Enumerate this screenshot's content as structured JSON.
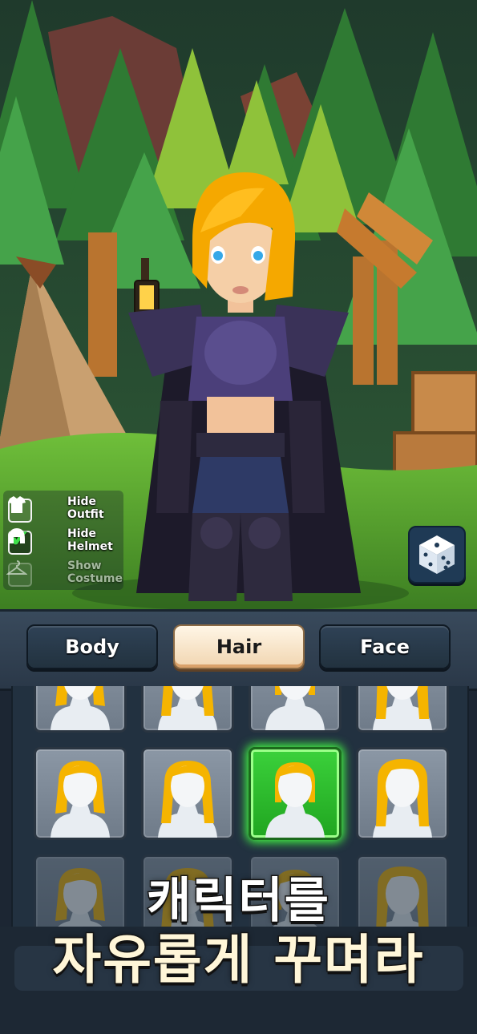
{
  "toggles": [
    {
      "label": "Hide\nOutfit",
      "checked": false,
      "icon": "shirt-icon"
    },
    {
      "label": "Hide\nHelmet",
      "checked": true,
      "icon": "helmet-icon"
    },
    {
      "label": "Show\nCostume",
      "checked": false,
      "icon": "hanger-icon"
    }
  ],
  "tabs": {
    "body": "Body",
    "hair": "Hair",
    "face": "Face",
    "active": "Hair"
  },
  "hair_grid": {
    "selected_index": 6,
    "items": [
      "hair-style-1",
      "hair-style-2",
      "hair-style-3",
      "hair-style-4",
      "hair-style-5",
      "hair-style-6",
      "hair-style-7",
      "hair-style-8",
      "hair-style-9",
      "hair-style-10",
      "hair-style-11",
      "hair-style-12"
    ]
  },
  "promo": {
    "line1": "캐릭터를",
    "line2": "자유롭게 꾸며라"
  },
  "colors": {
    "hair_color": "#f5b400",
    "selected_tile": "#2bbf2b",
    "tab_active": "#f6e6cf"
  }
}
